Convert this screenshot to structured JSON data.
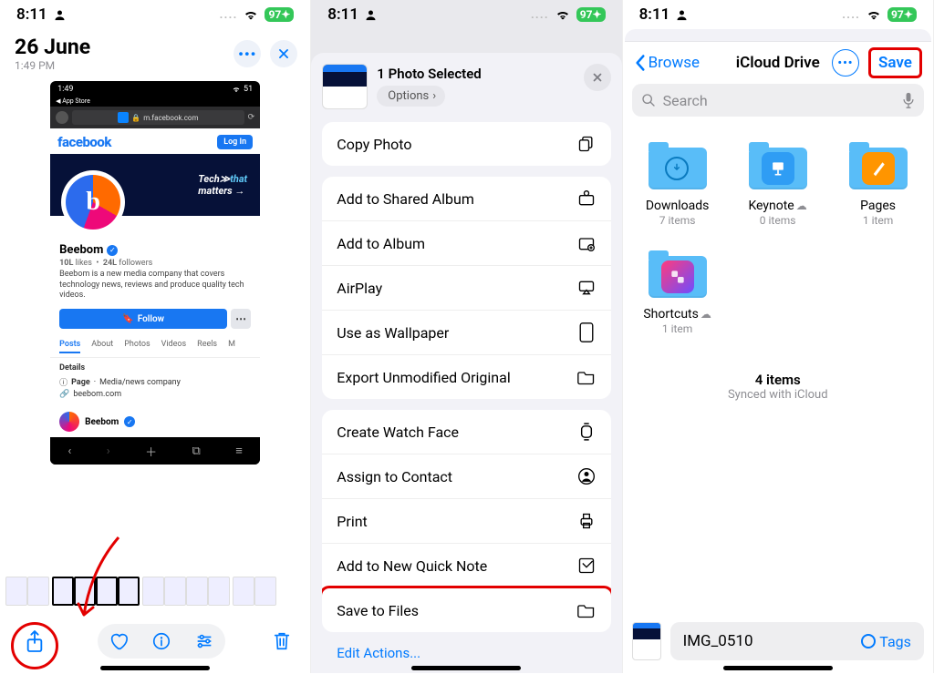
{
  "status": {
    "time": "8:11",
    "battery": "97"
  },
  "screen1": {
    "date": "26 June",
    "time": "1:49 PM",
    "photo": {
      "status_time": "1:49",
      "battery": "51",
      "app_return": "App Store",
      "url": "m.facebook.com",
      "fb_logo": "facebook",
      "login": "Log In",
      "cover_line1": "Tech",
      "cover_line2_blue": "that",
      "cover_line3": "matters",
      "page_name": "Beebom",
      "likes": "10L",
      "likes_label": "likes",
      "followers": "24L",
      "followers_label": "followers",
      "desc": "Beebom is a new media company that covers technology news, reviews and produce quality tech videos.",
      "follow": "Follow",
      "tabs": [
        "Posts",
        "About",
        "Photos",
        "Videos",
        "Reels",
        "M"
      ],
      "details_label": "Details",
      "detail_page": "Page",
      "detail_category": "Media/news company",
      "detail_link": "beebom.com",
      "post_author": "Beebom"
    }
  },
  "screen2": {
    "title": "1 Photo Selected",
    "options": "Options",
    "actions1": [
      "Copy Photo"
    ],
    "actions2": [
      "Add to Shared Album",
      "Add to Album",
      "AirPlay",
      "Use as Wallpaper",
      "Export Unmodified Original"
    ],
    "actions3": [
      "Create Watch Face",
      "Assign to Contact",
      "Print",
      "Add to New Quick Note",
      "Save to Files"
    ],
    "edit": "Edit Actions..."
  },
  "screen3": {
    "back": "Browse",
    "title": "iCloud Drive",
    "save": "Save",
    "search": "Search",
    "folders": [
      {
        "name": "Downloads",
        "sub": "7 items",
        "cloud": false
      },
      {
        "name": "Keynote",
        "sub": "0 items",
        "cloud": true
      },
      {
        "name": "Pages",
        "sub": "1 item",
        "cloud": false
      },
      {
        "name": "Shortcuts",
        "sub": "1 item",
        "cloud": true
      }
    ],
    "count": "4 items",
    "sync": "Synced with iCloud",
    "file": "IMG_0510",
    "tags": "Tags"
  }
}
